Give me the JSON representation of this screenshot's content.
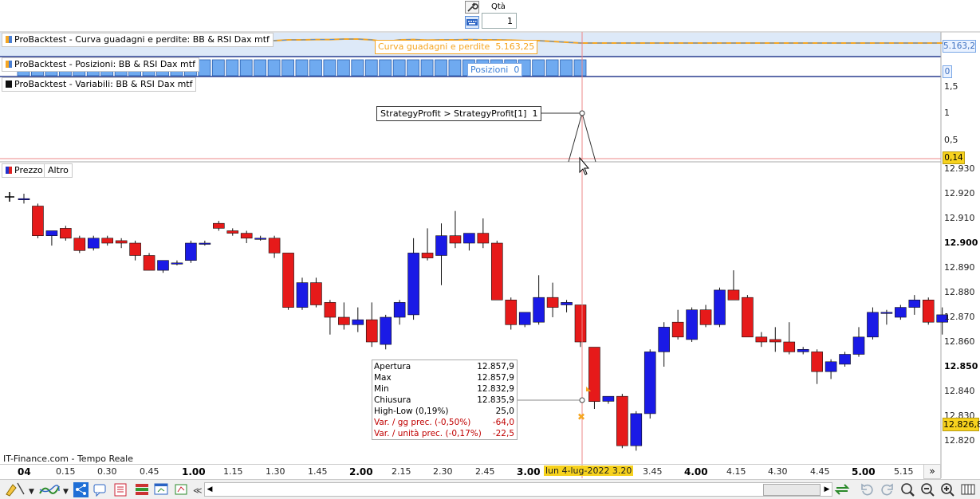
{
  "toolbar": {
    "qty_label": "Qtà",
    "qty_value": "1"
  },
  "panels": {
    "equity": {
      "tag": "ProBacktest - Curva guadagni e perdite: BB & RSI Dax mtf",
      "legend_label": "Curva guadagni e perdite",
      "legend_value": "5.163,25",
      "axis_value": "5.163,2",
      "color": "#f5a623"
    },
    "positions": {
      "tag": "ProBacktest - Posizioni: BB & RSI Dax mtf",
      "legend_label": "Posizioni",
      "legend_value": "0",
      "axis_value": "0",
      "color": "#3b8fe6"
    },
    "variables": {
      "tag": "ProBacktest - Variabili: BB & RSI Dax mtf",
      "callout": "StrategyProfit > StrategyProfit[1]",
      "callout_value": "1",
      "axis_ticks": [
        "1,5",
        "1",
        "0,5"
      ],
      "axis_current": "0,14"
    },
    "price": {
      "tag_price": "Prezzo",
      "tag_other": "Altro",
      "watermark": "IT-Finance.com - Tempo Reale",
      "current_price": "12.826,8"
    }
  },
  "tooltip": {
    "rows": [
      {
        "label": "Apertura",
        "value": "12.857,9",
        "color": "#000"
      },
      {
        "label": "Max",
        "value": "12.857,9",
        "color": "#000"
      },
      {
        "label": "Min",
        "value": "12.832,9",
        "color": "#000"
      },
      {
        "label": "Chiusura",
        "value": "12.835,9",
        "color": "#000"
      },
      {
        "label": "High-Low (0,19%)",
        "value": "25,0",
        "color": "#000"
      },
      {
        "label": "Var. / gg prec. (-0,50%)",
        "value": "-64,0",
        "color": "#c00000"
      },
      {
        "label": "Var. / unità prec. (-0,17%)",
        "value": "-22,5",
        "color": "#c00000"
      }
    ]
  },
  "chart_data": {
    "type": "candlestick",
    "ylim": [
      12815,
      12933
    ],
    "y_ticks": [
      "12.930",
      "12.920",
      "12.910",
      "12.900",
      "12.890",
      "12.880",
      "12.870",
      "12.860",
      "12.850",
      "12.840",
      "12.830",
      "12.820"
    ],
    "y_ticks_bold": [
      "12.900",
      "12.850"
    ],
    "x_labels": [
      "04",
      "0.15",
      "0.30",
      "0.45",
      "1.00",
      "1.15",
      "1.30",
      "1.45",
      "2.00",
      "2.15",
      "2.30",
      "2.45",
      "3.00",
      "lun 4-lug-2022 3.20",
      "3.45",
      "4.00",
      "4.15",
      "4.30",
      "4.45",
      "5.00",
      "5.15"
    ],
    "x_labels_bold": [
      "04",
      "1.00",
      "2.00",
      "3.00",
      "4.00",
      "5.00"
    ],
    "crosshair_label": "lun 4-lug-2022 3.20",
    "up_color": "#1a1ae6",
    "down_color": "#e61a1a",
    "candles": [
      {
        "o": 12918,
        "h": 12920,
        "l": 12916,
        "c": 12918
      },
      {
        "o": 12915,
        "h": 12916,
        "l": 12902,
        "c": 12903
      },
      {
        "o": 12903,
        "h": 12905,
        "l": 12899,
        "c": 12905
      },
      {
        "o": 12906,
        "h": 12907,
        "l": 12901,
        "c": 12902
      },
      {
        "o": 12902,
        "h": 12903,
        "l": 12896,
        "c": 12897
      },
      {
        "o": 12898,
        "h": 12903,
        "l": 12897,
        "c": 12902
      },
      {
        "o": 12902,
        "h": 12903,
        "l": 12899,
        "c": 12900
      },
      {
        "o": 12901,
        "h": 12902,
        "l": 12898,
        "c": 12900
      },
      {
        "o": 12900,
        "h": 12901,
        "l": 12893,
        "c": 12895
      },
      {
        "o": 12895,
        "h": 12896,
        "l": 12889,
        "c": 12889
      },
      {
        "o": 12889,
        "h": 12893,
        "l": 12888,
        "c": 12893
      },
      {
        "o": 12892,
        "h": 12893,
        "l": 12891,
        "c": 12892
      },
      {
        "o": 12893,
        "h": 12901,
        "l": 12892,
        "c": 12900
      },
      {
        "o": 12900,
        "h": 12901,
        "l": 12899,
        "c": 12900
      },
      {
        "o": 12908,
        "h": 12909,
        "l": 12905,
        "c": 12906
      },
      {
        "o": 12905,
        "h": 12906,
        "l": 12903,
        "c": 12904
      },
      {
        "o": 12904,
        "h": 12905,
        "l": 12900,
        "c": 12902
      },
      {
        "o": 12902,
        "h": 12903,
        "l": 12901,
        "c": 12902
      },
      {
        "o": 12902,
        "h": 12903,
        "l": 12894,
        "c": 12896
      },
      {
        "o": 12896,
        "h": 12896,
        "l": 12873,
        "c": 12874
      },
      {
        "o": 12874,
        "h": 12886,
        "l": 12873,
        "c": 12884
      },
      {
        "o": 12884,
        "h": 12886,
        "l": 12874,
        "c": 12875
      },
      {
        "o": 12876,
        "h": 12877,
        "l": 12863,
        "c": 12870
      },
      {
        "o": 12870,
        "h": 12876,
        "l": 12865,
        "c": 12867
      },
      {
        "o": 12867,
        "h": 12874,
        "l": 12864,
        "c": 12869
      },
      {
        "o": 12869,
        "h": 12876,
        "l": 12858,
        "c": 12860
      },
      {
        "o": 12859,
        "h": 12871,
        "l": 12857,
        "c": 12870
      },
      {
        "o": 12870,
        "h": 12877,
        "l": 12867,
        "c": 12876
      },
      {
        "o": 12871,
        "h": 12902,
        "l": 12869,
        "c": 12896
      },
      {
        "o": 12896,
        "h": 12906,
        "l": 12893,
        "c": 12894
      },
      {
        "o": 12895,
        "h": 12908,
        "l": 12883,
        "c": 12903
      },
      {
        "o": 12903,
        "h": 12913,
        "l": 12898,
        "c": 12900
      },
      {
        "o": 12900,
        "h": 12904,
        "l": 12897,
        "c": 12904
      },
      {
        "o": 12904,
        "h": 12910,
        "l": 12898,
        "c": 12900
      },
      {
        "o": 12900,
        "h": 12901,
        "l": 12877,
        "c": 12877
      },
      {
        "o": 12877,
        "h": 12878,
        "l": 12865,
        "c": 12867
      },
      {
        "o": 12867,
        "h": 12871,
        "l": 12866,
        "c": 12872
      },
      {
        "o": 12868,
        "h": 12887,
        "l": 12867,
        "c": 12878
      },
      {
        "o": 12878,
        "h": 12884,
        "l": 12870,
        "c": 12874
      },
      {
        "o": 12875,
        "h": 12877,
        "l": 12872,
        "c": 12876
      },
      {
        "o": 12875,
        "h": 12875,
        "l": 12858,
        "c": 12860
      },
      {
        "o": 12857.9,
        "h": 12857.9,
        "l": 12832.9,
        "c": 12835.9
      },
      {
        "o": 12836,
        "h": 12838,
        "l": 12835,
        "c": 12838
      },
      {
        "o": 12838,
        "h": 12839,
        "l": 12817,
        "c": 12818
      },
      {
        "o": 12818,
        "h": 12832,
        "l": 12816,
        "c": 12831
      },
      {
        "o": 12831,
        "h": 12857,
        "l": 12829,
        "c": 12856
      },
      {
        "o": 12856,
        "h": 12868,
        "l": 12850,
        "c": 12866
      },
      {
        "o": 12868,
        "h": 12873,
        "l": 12861,
        "c": 12862
      },
      {
        "o": 12861,
        "h": 12874,
        "l": 12860,
        "c": 12873
      },
      {
        "o": 12873,
        "h": 12875,
        "l": 12866,
        "c": 12867
      },
      {
        "o": 12867,
        "h": 12882,
        "l": 12866,
        "c": 12881
      },
      {
        "o": 12881,
        "h": 12889,
        "l": 12877,
        "c": 12877
      },
      {
        "o": 12878,
        "h": 12879,
        "l": 12862,
        "c": 12862
      },
      {
        "o": 12862,
        "h": 12864,
        "l": 12858,
        "c": 12860
      },
      {
        "o": 12861,
        "h": 12866,
        "l": 12856,
        "c": 12860
      },
      {
        "o": 12860,
        "h": 12868,
        "l": 12855,
        "c": 12856
      },
      {
        "o": 12856,
        "h": 12858,
        "l": 12855,
        "c": 12857
      },
      {
        "o": 12856,
        "h": 12857,
        "l": 12843,
        "c": 12848
      },
      {
        "o": 12848,
        "h": 12853,
        "l": 12845,
        "c": 12852
      },
      {
        "o": 12851,
        "h": 12856,
        "l": 12850,
        "c": 12855
      },
      {
        "o": 12855,
        "h": 12866,
        "l": 12854,
        "c": 12862
      },
      {
        "o": 12862,
        "h": 12874,
        "l": 12861,
        "c": 12872
      },
      {
        "o": 12872,
        "h": 12873,
        "l": 12867,
        "c": 12872
      },
      {
        "o": 12870,
        "h": 12875,
        "l": 12869,
        "c": 12874
      },
      {
        "o": 12874,
        "h": 12879,
        "l": 12871,
        "c": 12877
      },
      {
        "o": 12877,
        "h": 12878,
        "l": 12867,
        "c": 12868
      },
      {
        "o": 12868,
        "h": 12874,
        "l": 12863,
        "c": 12871
      }
    ],
    "equity_curve": [
      0.62,
      0.62,
      0.6,
      0.58,
      0.6,
      0.55,
      0.58,
      0.5,
      0.55,
      0.5,
      0.52,
      0.45,
      0.5,
      0.4,
      0.42,
      0.35,
      0.38,
      0.32,
      0.35,
      0.3,
      0.3,
      0.28,
      0.28,
      0.25,
      0.25,
      0.3,
      0.42,
      0.3,
      0.28,
      0.32,
      0.3,
      0.3,
      0.28,
      0.3,
      0.3,
      0.32,
      0.35,
      0.35,
      0.4,
      0.45,
      0.5,
      0.5,
      0.5,
      0.5,
      0.5,
      0.5,
      0.5,
      0.5,
      0.5,
      0.5,
      0.5,
      0.5,
      0.5,
      0.5,
      0.5,
      0.5,
      0.5,
      0.5,
      0.5,
      0.5,
      0.5,
      0.5,
      0.5,
      0.5,
      0.5,
      0.5,
      0.5
    ]
  },
  "status": {
    "bottom_tools": [
      "draw-tool",
      "indicator",
      "share",
      "comment",
      "list",
      "stack",
      "window",
      "trade"
    ]
  }
}
